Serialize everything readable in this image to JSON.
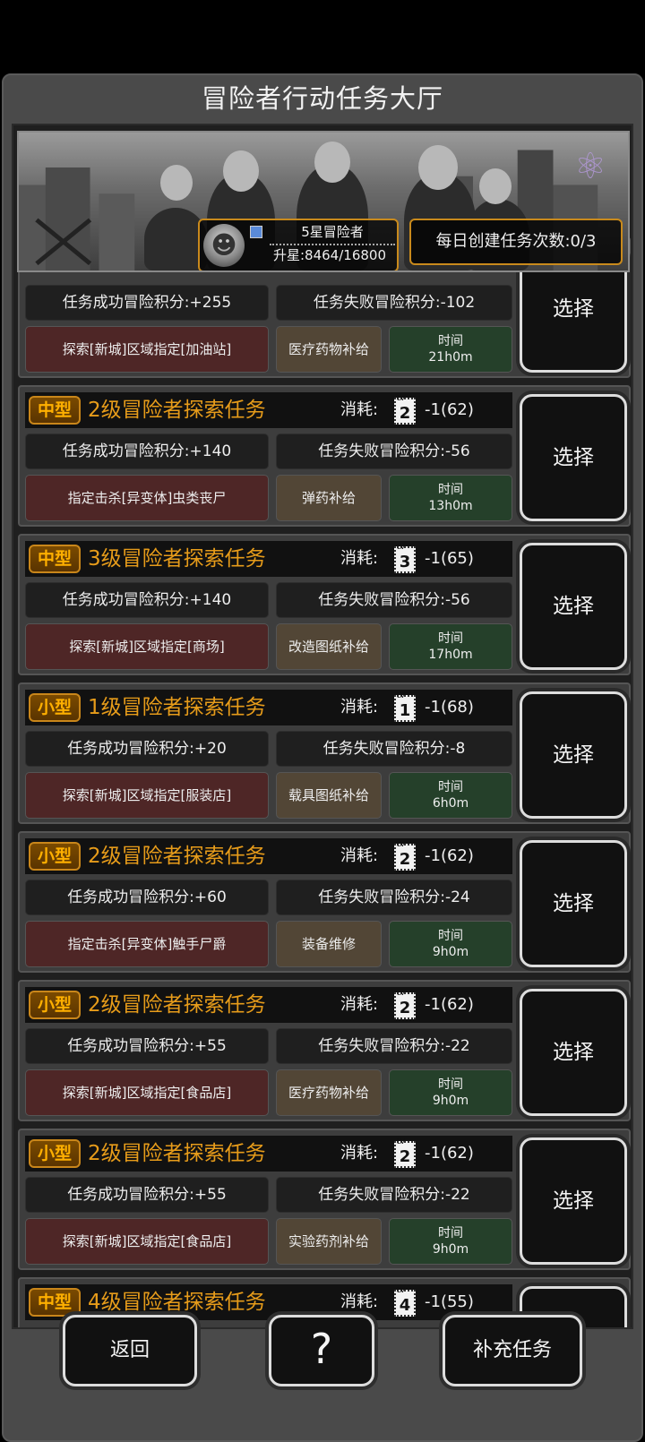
{
  "title": "冒险者行动任务大厅",
  "rank": {
    "name": "5星冒险者",
    "star_progress": "升星:8464/16800"
  },
  "daily": "每日创建任务次数:0/3",
  "cost_label": "消耗:",
  "select_label": "选择",
  "tasks": [
    {
      "success": "任务成功冒险积分:+255",
      "fail": "任务失败冒险积分:-102",
      "target": "探索[新城]区域指定[加油站]",
      "supply": "医疗药物补给",
      "time_label": "时间",
      "time": "21h0m"
    },
    {
      "size": "中型",
      "name": "2级冒险者探索任务",
      "ticket": "2",
      "cost": "-1(62)",
      "success": "任务成功冒险积分:+140",
      "fail": "任务失败冒险积分:-56",
      "target": "指定击杀[异变体]虫类丧尸",
      "supply": "弹药补给",
      "time_label": "时间",
      "time": "13h0m"
    },
    {
      "size": "中型",
      "name": "3级冒险者探索任务",
      "ticket": "3",
      "cost": "-1(65)",
      "success": "任务成功冒险积分:+140",
      "fail": "任务失败冒险积分:-56",
      "target": "探索[新城]区域指定[商场]",
      "supply": "改造图纸补给",
      "time_label": "时间",
      "time": "17h0m"
    },
    {
      "size": "小型",
      "name": "1级冒险者探索任务",
      "ticket": "1",
      "cost": "-1(68)",
      "success": "任务成功冒险积分:+20",
      "fail": "任务失败冒险积分:-8",
      "target": "探索[新城]区域指定[服装店]",
      "supply": "载具图纸补给",
      "time_label": "时间",
      "time": "6h0m"
    },
    {
      "size": "小型",
      "name": "2级冒险者探索任务",
      "ticket": "2",
      "cost": "-1(62)",
      "success": "任务成功冒险积分:+60",
      "fail": "任务失败冒险积分:-24",
      "target": "指定击杀[异变体]触手尸爵",
      "supply": "装备维修",
      "time_label": "时间",
      "time": "9h0m"
    },
    {
      "size": "小型",
      "name": "2级冒险者探索任务",
      "ticket": "2",
      "cost": "-1(62)",
      "success": "任务成功冒险积分:+55",
      "fail": "任务失败冒险积分:-22",
      "target": "探索[新城]区域指定[食品店]",
      "supply": "医疗药物补给",
      "time_label": "时间",
      "time": "9h0m"
    },
    {
      "size": "小型",
      "name": "2级冒险者探索任务",
      "ticket": "2",
      "cost": "-1(62)",
      "success": "任务成功冒险积分:+55",
      "fail": "任务失败冒险积分:-22",
      "target": "探索[新城]区域指定[食品店]",
      "supply": "实验药剂补给",
      "time_label": "时间",
      "time": "9h0m"
    },
    {
      "size": "中型",
      "name": "4级冒险者探索任务",
      "ticket": "4",
      "cost": "-1(55)"
    }
  ],
  "footer": {
    "back": "返回",
    "help_icon": "question-pin-icon",
    "refill": "补充任务"
  },
  "colors": {
    "accent": "#c98a1c",
    "task_name": "#e79c1a",
    "target_bg": "#4e2626",
    "supply_bg": "#524636",
    "time_bg": "#25402a"
  }
}
